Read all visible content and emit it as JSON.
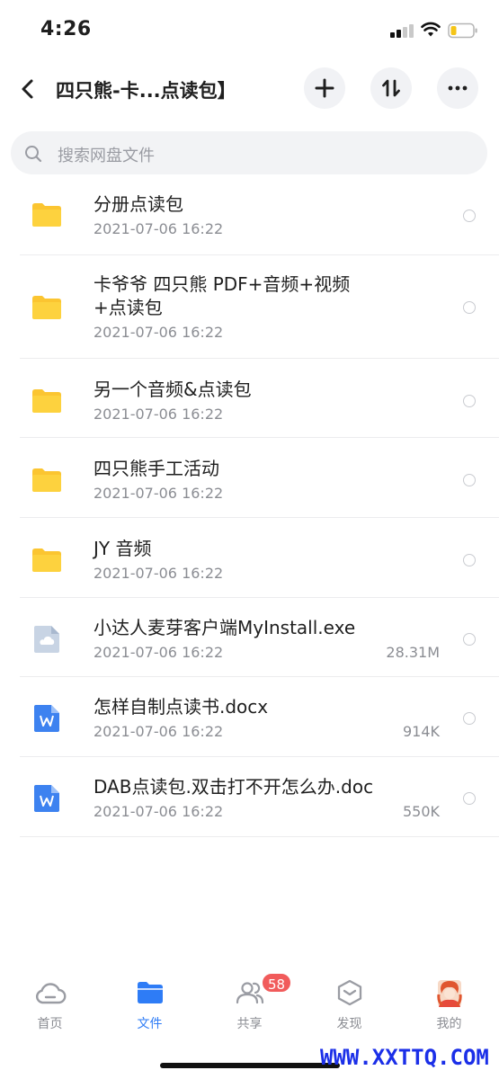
{
  "status_bar": {
    "time": "4:26"
  },
  "header": {
    "title": "四只熊-卡...点读包】"
  },
  "search": {
    "placeholder": "搜索网盘文件"
  },
  "files": [
    {
      "name": "分册点读包",
      "date": "2021-07-06 16:22",
      "size": "",
      "type": "folder"
    },
    {
      "name": "卡爷爷 四只熊 PDF+音频+视频+点读包",
      "date": "2021-07-06 16:22",
      "size": "",
      "type": "folder"
    },
    {
      "name": "另一个音频&点读包",
      "date": "2021-07-06 16:22",
      "size": "",
      "type": "folder"
    },
    {
      "name": "四只熊手工活动",
      "date": "2021-07-06 16:22",
      "size": "",
      "type": "folder"
    },
    {
      "name": "JY 音频",
      "date": "2021-07-06 16:22",
      "size": "",
      "type": "folder"
    },
    {
      "name": "小达人麦芽客户端MyInstall.exe",
      "date": "2021-07-06 16:22",
      "size": "28.31M",
      "type": "exe"
    },
    {
      "name": "怎样自制点读书.docx",
      "date": "2021-07-06 16:22",
      "size": "914K",
      "type": "doc"
    },
    {
      "name": "DAB点读包.双击打不开怎么办.doc",
      "date": "2021-07-06 16:22",
      "size": "550K",
      "type": "doc"
    }
  ],
  "tabs": [
    {
      "label": "首页",
      "icon": "cloud-icon"
    },
    {
      "label": "文件",
      "icon": "folder-icon"
    },
    {
      "label": "共享",
      "icon": "people-icon",
      "badge": "58"
    },
    {
      "label": "发现",
      "icon": "cube-icon"
    },
    {
      "label": "我的",
      "icon": "avatar-icon"
    }
  ],
  "watermark": "WWW.XXTTQ.COM",
  "colors": {
    "accent": "#2e7cf6",
    "folder": "#fbc531",
    "badge": "#f15b5b",
    "doc": "#3d82f0"
  }
}
